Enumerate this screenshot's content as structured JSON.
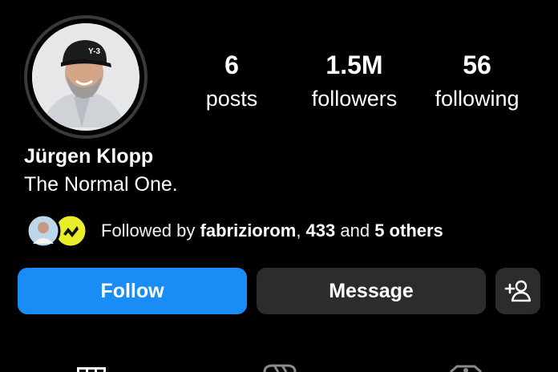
{
  "profile": {
    "name": "Jürgen Klopp",
    "bio": "The Normal One.",
    "avatar_icon": "profile-photo"
  },
  "stats": [
    {
      "value": "6",
      "label": "posts"
    },
    {
      "value": "1.5M",
      "label": "followers"
    },
    {
      "value": "56",
      "label": "following"
    }
  ],
  "mutual": {
    "prefix": "Followed by ",
    "user": "fabriziorom",
    "separator": ", ",
    "count": "433",
    "middle": " and ",
    "others": "5 others"
  },
  "actions": {
    "follow_label": "Follow",
    "message_label": "Message",
    "add_user_icon": "add-user-icon"
  },
  "tabs": [
    {
      "icon": "grid-icon"
    },
    {
      "icon": "reels-icon"
    },
    {
      "icon": "tagged-icon"
    }
  ],
  "colors": {
    "background": "#000000",
    "follow_button": "#1a8cf5",
    "secondary_button": "#2c2c2c",
    "text": "#ffffff"
  }
}
